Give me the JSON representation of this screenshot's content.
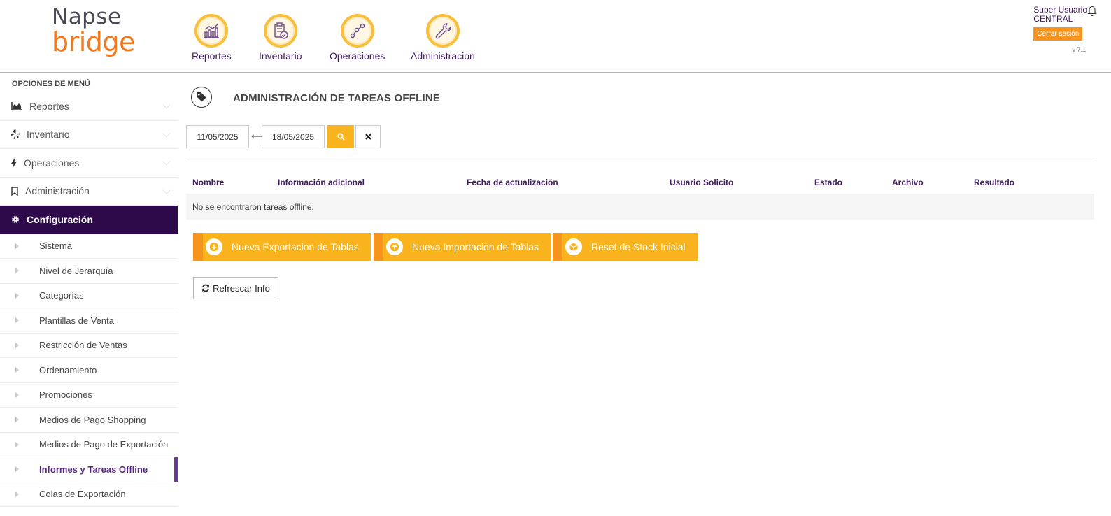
{
  "brand": {
    "line1": "Napse",
    "line2": "bridge"
  },
  "topnav": [
    {
      "label": "Reportes",
      "icon": "chart-icon"
    },
    {
      "label": "Inventario",
      "icon": "clipboard-check-icon"
    },
    {
      "label": "Operaciones",
      "icon": "nodes-icon"
    },
    {
      "label": "Administracion",
      "icon": "wrench-icon"
    }
  ],
  "user": {
    "name": "Super Usuario",
    "role": "CENTRAL",
    "logout_label": "Cerrar sesión",
    "version": "v 7.1"
  },
  "sidebar": {
    "title": "OPCIONES DE MENÚ",
    "main_items": [
      {
        "label": "Reportes",
        "icon": "area-chart-icon"
      },
      {
        "label": "Inventario",
        "icon": "yelp-like-icon"
      },
      {
        "label": "Operaciones",
        "icon": "bolt-icon"
      },
      {
        "label": "Administración",
        "icon": "bookmark-icon"
      },
      {
        "label": "Configuración",
        "icon": "gear-icon"
      }
    ],
    "sub_items": [
      {
        "label": "Sistema"
      },
      {
        "label": "Nivel de Jerarquía"
      },
      {
        "label": "Categorías"
      },
      {
        "label": "Plantillas de Venta"
      },
      {
        "label": "Restricción de Ventas"
      },
      {
        "label": "Ordenamiento"
      },
      {
        "label": "Promociones"
      },
      {
        "label": "Medios de Pago Shopping"
      },
      {
        "label": "Medios de Pago de Exportación"
      },
      {
        "label": "Informes y Tareas Offline"
      },
      {
        "label": "Colas de Exportación"
      }
    ],
    "active_main": "Configuración",
    "current_sub": "Informes y Tareas Offline"
  },
  "page": {
    "title": "ADMINISTRACIÓN DE TAREAS OFFLINE",
    "date_from": "11/05/2025",
    "date_to": "18/05/2025",
    "date_separator": "⟷"
  },
  "table": {
    "headers": [
      "Nombre",
      "Información adicional",
      "Fecha de actualización",
      "Usuario Solicito",
      "Estado",
      "Archivo",
      "Resultado"
    ],
    "empty_message": "No se encontraron tareas offline."
  },
  "actions": {
    "export_label": "Nueva Exportacion de Tablas",
    "import_label": "Nueva Importacion de Tablas",
    "reset_label": "Reset de Stock Inicial",
    "refresh_label": "Refrescar Info"
  },
  "colors": {
    "accent": "#f9b31c",
    "accent_dark": "#f7941d",
    "brand_purple": "#2e0a4a",
    "label_purple": "#3e1a5c"
  }
}
